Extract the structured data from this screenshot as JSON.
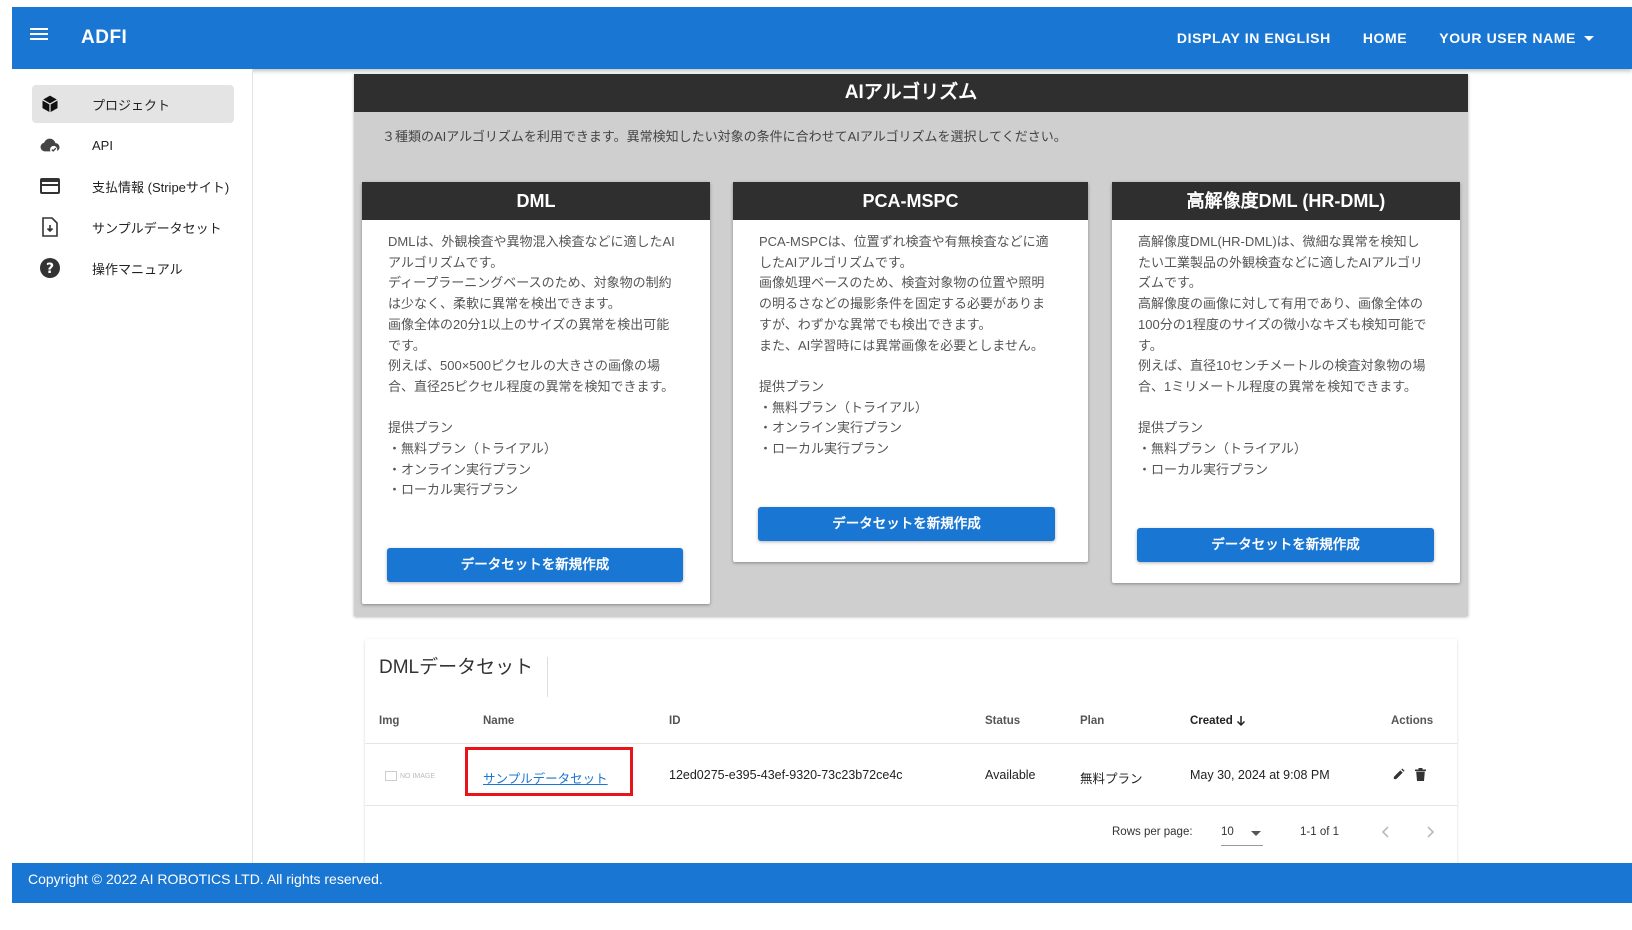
{
  "appbar": {
    "title": "ADFI",
    "display_english": "DISPLAY IN ENGLISH",
    "home": "HOME",
    "user": "YOUR USER NAME"
  },
  "sidebar": {
    "items": [
      {
        "label": "プロジェクト",
        "icon": "cube-icon",
        "active": true
      },
      {
        "label": "API",
        "icon": "cloud-icon",
        "active": false
      },
      {
        "label": "支払情報 (Stripeサイト)",
        "icon": "credit-card-icon",
        "active": false
      },
      {
        "label": "サンプルデータセット",
        "icon": "file-download-icon",
        "active": false
      },
      {
        "label": "操作マニュアル",
        "icon": "help-icon",
        "active": false
      }
    ]
  },
  "algorithms": {
    "title": "AIアルゴリズム",
    "description": "３種類のAIアルゴリズムを利用できます。異常検知したい対象の条件に合わせてAIアルゴリズムを選択してください。",
    "cards": [
      {
        "title": "DML",
        "body": [
          "DMLは、外観検査や異物混入検査などに適したAI",
          "アルゴリズムです。",
          "ディープラーニングベースのため、対象物の制約",
          "は少なく、柔軟に異常を検出できます。",
          "画像全体の20分1以上のサイズの異常を検出可能",
          "です。",
          "例えば、500×500ピクセルの大きさの画像の場",
          "合、直径25ピクセル程度の異常を検知できます。",
          "",
          "提供プラン",
          "・無料プラン（トライアル）",
          "・オンライン実行プラン",
          "・ローカル実行プラン"
        ],
        "button": "データセットを新規作成"
      },
      {
        "title": "PCA-MSPC",
        "body": [
          "PCA-MSPCは、位置ずれ検査や有無検査などに適",
          "したAIアルゴリズムです。",
          "画像処理ベースのため、検査対象物の位置や照明",
          "の明るさなどの撮影条件を固定する必要がありま",
          "すが、わずかな異常でも検出できます。",
          "また、AI学習時には異常画像を必要としません。",
          "",
          "提供プラン",
          "・無料プラン（トライアル）",
          "・オンライン実行プラン",
          "・ローカル実行プラン"
        ],
        "button": "データセットを新規作成"
      },
      {
        "title": "高解像度DML (HR-DML)",
        "body": [
          "高解像度DML(HR-DML)は、微細な異常を検知し",
          "たい工業製品の外観検査などに適したAIアルゴリ",
          "ズムです。",
          "高解像度の画像に対して有用であり、画像全体の",
          "100分の1程度のサイズの微小なキズも検知可能で",
          "す。",
          "例えば、直径10センチメートルの検査対象物の場",
          "合、1ミリメートル程度の異常を検知できます。",
          "",
          "提供プラン",
          "・無料プラン（トライアル）",
          "・ローカル実行プラン"
        ],
        "button": "データセットを新規作成"
      }
    ]
  },
  "datasets": {
    "title": "DMLデータセット",
    "columns": [
      "Img",
      "Name",
      "ID",
      "Status",
      "Plan",
      "Created",
      "Actions"
    ],
    "rows": [
      {
        "img": "NO IMAGE",
        "name": "サンプルデータセット",
        "id": "12ed0275-e395-43ef-9320-73c23b72ce4c",
        "status": "Available",
        "plan": "無料プラン",
        "created": "May 30, 2024 at 9:08 PM"
      }
    ],
    "rows_per_page_label": "Rows per page:",
    "rows_per_page": "10",
    "range": "1-1 of 1"
  },
  "footer": {
    "copyright": "Copyright © 2022 AI ROBOTICS LTD. All rights reserved."
  },
  "colors": {
    "primary": "#1976d2",
    "header_dark": "#2f2f2f",
    "section_gray": "#cfcfcf",
    "highlight": "#e8141a"
  }
}
